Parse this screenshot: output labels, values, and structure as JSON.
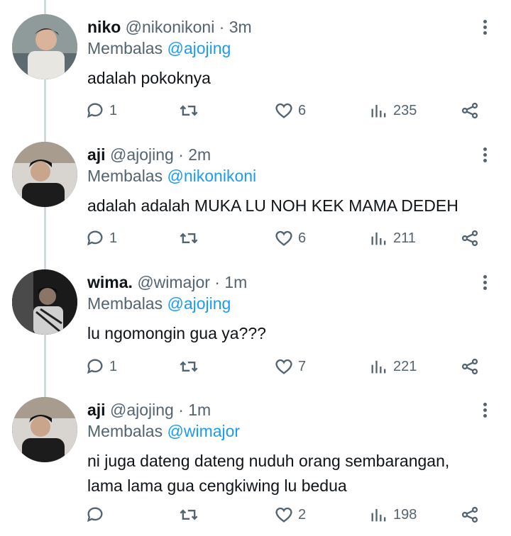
{
  "reply_prefix": "Membalas",
  "icons": [
    "more-icon",
    "reply-icon",
    "retweet-icon",
    "like-icon",
    "views-icon",
    "share-icon"
  ],
  "colors": {
    "mention": "#1d9bf0",
    "muted": "#536471",
    "text": "#0f1419"
  },
  "tweets": [
    {
      "name": "niko",
      "handle": "@nikonikoni",
      "sep": "·",
      "time": "3m",
      "reply_to": "@ajojing",
      "text": "adalah pokoknya",
      "replies": "1",
      "likes": "6",
      "views": "235"
    },
    {
      "name": "aji",
      "handle": "@ajojing",
      "sep": "·",
      "time": "2m",
      "reply_to": "@nikonikoni",
      "text": "adalah adalah MUKA LU NOH KEK MAMA DEDEH",
      "replies": "1",
      "likes": "6",
      "views": "211"
    },
    {
      "name": "wima.",
      "handle": "@wimajor",
      "sep": "·",
      "time": "1m",
      "reply_to": "@ajojing",
      "text": "lu ngomongin gua ya???",
      "replies": "1",
      "likes": "7",
      "views": "221"
    },
    {
      "name": "aji",
      "handle": "@ajojing",
      "sep": "·",
      "time": "1m",
      "reply_to": "@wimajor",
      "text": "ni juga dateng dateng nuduh orang sembarangan,\nlama lama gua cengkiwing lu bedua",
      "replies": "",
      "likes": "2",
      "views": "198"
    }
  ]
}
